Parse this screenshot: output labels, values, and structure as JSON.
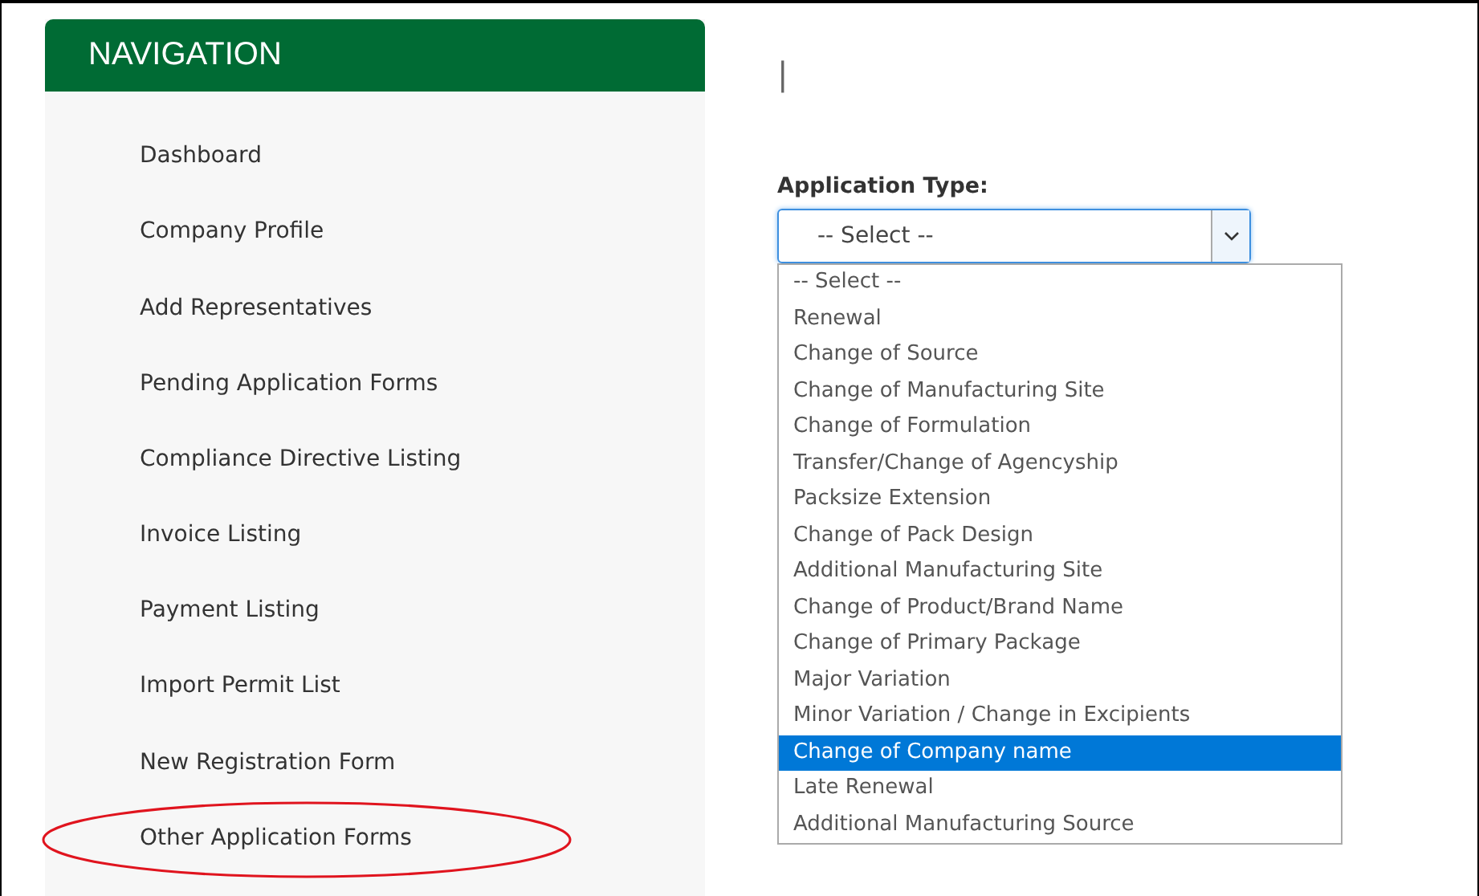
{
  "sidebar": {
    "title": "NAVIGATION",
    "items": [
      {
        "label": "Dashboard",
        "circled": false
      },
      {
        "label": "Company Profile",
        "circled": false
      },
      {
        "label": "Add Representatives",
        "circled": false
      },
      {
        "label": "Pending Application Forms",
        "circled": false
      },
      {
        "label": "Compliance Directive Listing",
        "circled": false
      },
      {
        "label": "Invoice Listing",
        "circled": false
      },
      {
        "label": "Payment Listing",
        "circled": false
      },
      {
        "label": "Import Permit List",
        "circled": false
      },
      {
        "label": "New Registration Form",
        "circled": false
      },
      {
        "label": "Other Application Forms",
        "circled": true
      }
    ]
  },
  "main": {
    "cursor": "|",
    "field_label": "Application Type:",
    "select": {
      "value": "-- Select --",
      "expanded": true,
      "options": [
        {
          "label": "-- Select --",
          "highlighted": false
        },
        {
          "label": "Renewal",
          "highlighted": false
        },
        {
          "label": "Change of Source",
          "highlighted": false
        },
        {
          "label": "Change of Manufacturing Site",
          "highlighted": false
        },
        {
          "label": "Change of Formulation",
          "highlighted": false
        },
        {
          "label": "Transfer/Change of Agencyship",
          "highlighted": false
        },
        {
          "label": "Packsize Extension",
          "highlighted": false
        },
        {
          "label": "Change of Pack Design",
          "highlighted": false
        },
        {
          "label": "Additional Manufacturing Site",
          "highlighted": false
        },
        {
          "label": "Change of Product/Brand Name",
          "highlighted": false
        },
        {
          "label": "Change of Primary Package",
          "highlighted": false
        },
        {
          "label": "Major Variation",
          "highlighted": false
        },
        {
          "label": "Minor Variation / Change in Excipients",
          "highlighted": false
        },
        {
          "label": "Change of Company name",
          "highlighted": true
        },
        {
          "label": "Late Renewal",
          "highlighted": false
        },
        {
          "label": "Additional Manufacturing Source",
          "highlighted": false
        }
      ]
    }
  }
}
